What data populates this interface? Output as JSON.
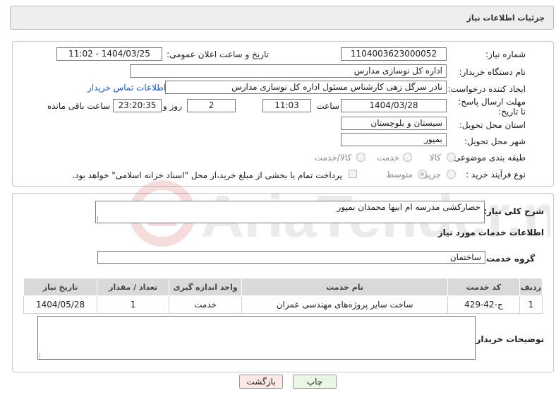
{
  "header": {
    "title": "جزئیات اطلاعات نیاز"
  },
  "form": {
    "need_number": {
      "label": "شماره نیاز:",
      "value": "1104003623000052"
    },
    "announce_datetime": {
      "label": "تاریخ و ساعت اعلان عمومی:",
      "value": "1404/03/25 - 11:02"
    },
    "buyer_org": {
      "label": "نام دستگاه خریدار:",
      "value": "اداره کل نوسازی مدارس"
    },
    "requester": {
      "label": "ایجاد کننده درخواست:",
      "value": "نادر سرگل زهی کارشناس مسئول اداره کل نوسازی مدارس",
      "contact_link": "اطلاعات تماس خریدار"
    },
    "deadline": {
      "label": "مهلت ارسال پاسخ: تا تاریخ:",
      "date": "1404/03/28",
      "time_label": "ساعت",
      "time": "11:03",
      "days": "2",
      "days_label": "روز و",
      "remaining": "23:20:35",
      "remaining_label": "ساعت باقی مانده"
    },
    "province": {
      "label": "استان محل تحویل:",
      "value": "سیستان و بلوچستان"
    },
    "city": {
      "label": "شهر محل تحویل:",
      "value": "بمپور"
    },
    "category": {
      "label": "طبقه بندی موضوعی:",
      "options": [
        "کالا",
        "خدمت",
        "کالا/خدمت"
      ],
      "selected": "خدمت"
    },
    "process_type": {
      "label": "نوع فرآیند خرید :",
      "options": [
        "جزیی",
        "متوسط"
      ],
      "selected": "متوسط",
      "payment_note": "پرداخت تمام یا بخشی از مبلغ خرید،از محل \"اسناد خزانه اسلامی\" خواهد بود."
    }
  },
  "description": {
    "label": "شرح کلی نیاز:",
    "value": "حصارکشی مدرسه ام ابیها محمدان بمپور"
  },
  "services": {
    "section_title": "اطلاعات خدمات مورد نیاز",
    "group_label": "گروه خدمت:",
    "group_value": "ساختمان",
    "columns": [
      "ردیف",
      "کد خدمت",
      "نام خدمت",
      "واحد اندازه گیری",
      "تعداد / مقدار",
      "تاریخ نیاز"
    ],
    "rows": [
      [
        "1",
        "ج-42-429",
        "ساخت سایر پروژه‌های مهندسی عمران",
        "خدمت",
        "1",
        "1404/05/28"
      ]
    ]
  },
  "buyer_notes": {
    "label": "توضیحات خریدار:",
    "value": ""
  },
  "buttons": {
    "print": "چاپ",
    "back": "بازگشت"
  },
  "watermark": {
    "text": "AriaTender.neT"
  },
  "colors": {
    "link": "#1a56c4",
    "back_button": "#fde8e8",
    "print_button": "#eaf7e4",
    "table_header": "#d9d9d9"
  }
}
